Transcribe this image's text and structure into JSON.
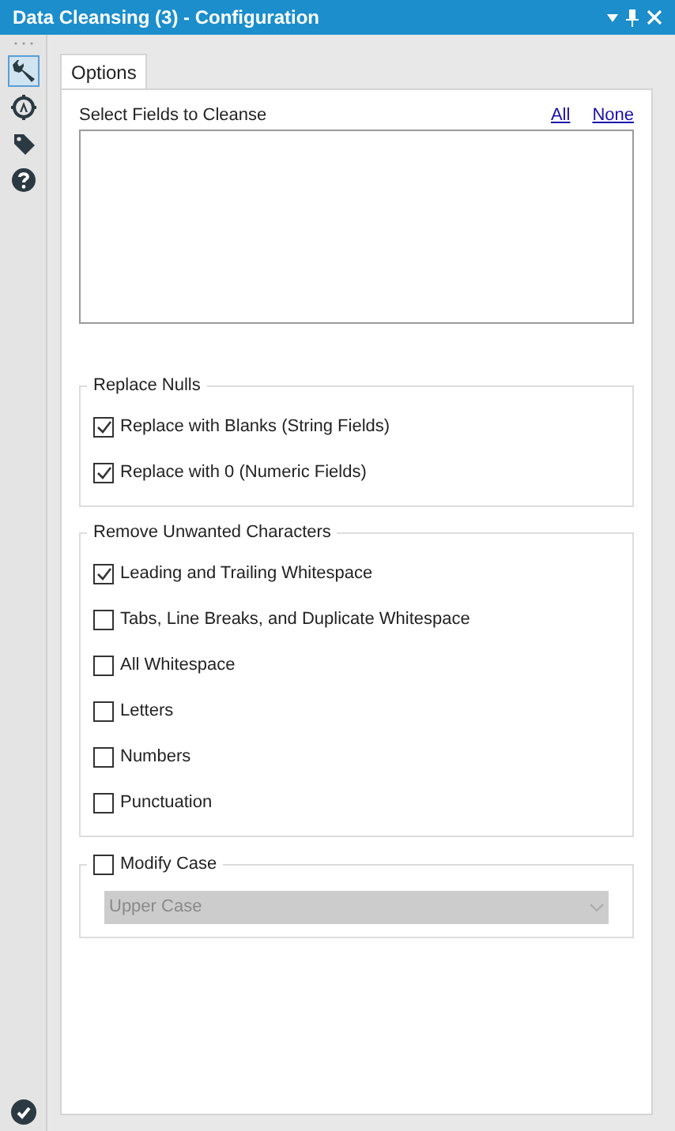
{
  "window": {
    "title": "Data Cleansing (3) - Configuration"
  },
  "toolbar": [
    {
      "kind": "wrench",
      "selected": true
    },
    {
      "kind": "target",
      "selected": false
    },
    {
      "kind": "tag",
      "selected": false
    },
    {
      "kind": "help",
      "selected": false
    }
  ],
  "tabs": [
    {
      "label": "Options",
      "selected": true
    }
  ],
  "fields": {
    "label": "Select Fields to Cleanse",
    "links": [
      "All",
      "None"
    ]
  },
  "groups": [
    {
      "title": "Replace Nulls",
      "options": [
        {
          "label": "Replace with Blanks (String Fields)",
          "checked": true
        },
        {
          "label": "Replace with 0 (Numeric Fields)",
          "checked": true
        }
      ]
    },
    {
      "title": "Remove Unwanted Characters",
      "options": [
        {
          "label": "Leading and Trailing Whitespace",
          "checked": true
        },
        {
          "label": "Tabs, Line Breaks, and Duplicate Whitespace",
          "checked": false
        },
        {
          "label": "All Whitespace",
          "checked": false
        },
        {
          "label": "Letters",
          "checked": false
        },
        {
          "label": "Numbers",
          "checked": false
        },
        {
          "label": "Punctuation",
          "checked": false
        }
      ]
    }
  ],
  "modify_case": {
    "label": "Modify Case",
    "checked": false,
    "dropdown": {
      "value": "Upper Case",
      "disabled": true
    }
  }
}
